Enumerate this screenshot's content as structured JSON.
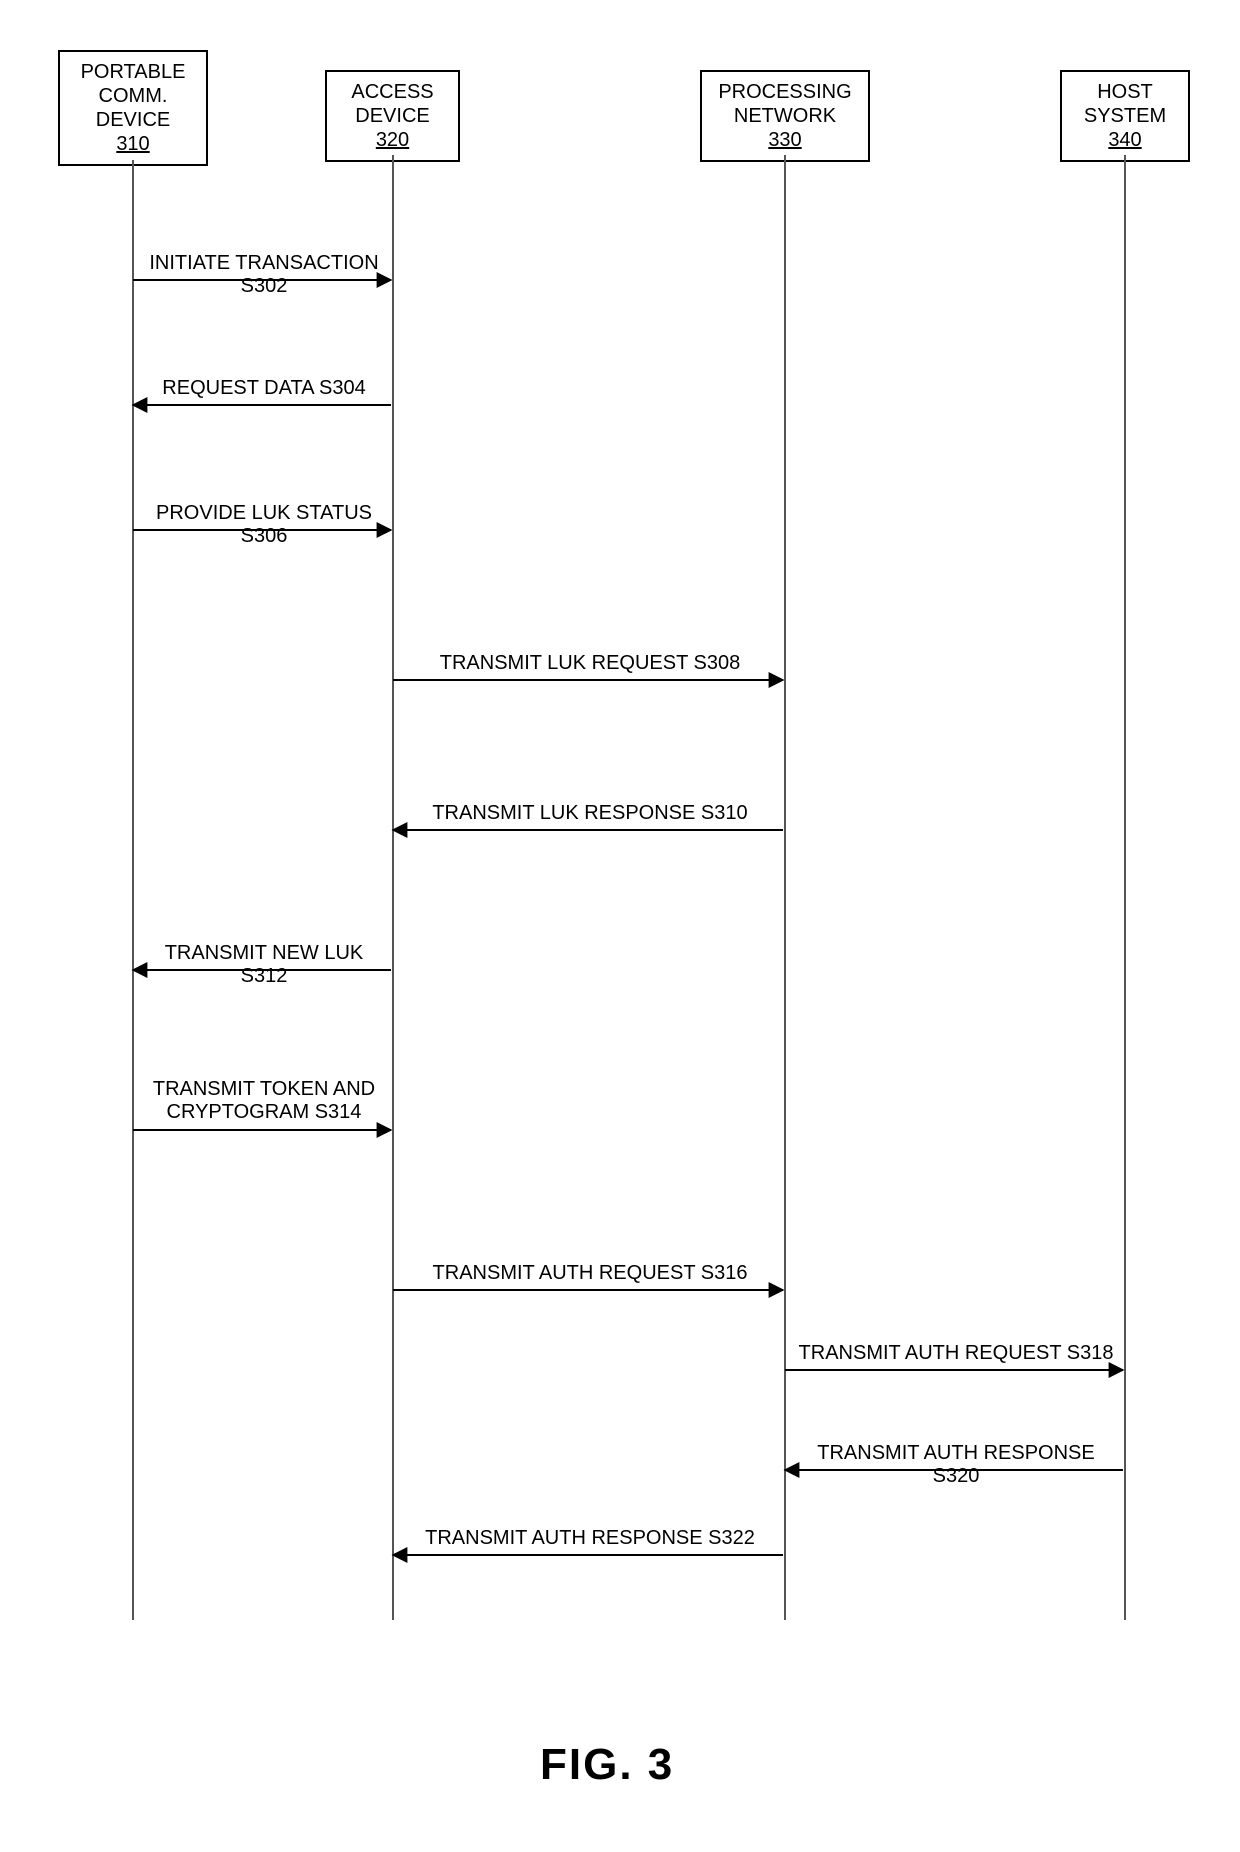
{
  "figure_label": "FIG. 3",
  "entities": {
    "portable": {
      "line1": "PORTABLE",
      "line2": "COMM.",
      "line3": "DEVICE",
      "ref": "310"
    },
    "access": {
      "line1": "ACCESS",
      "line2": "DEVICE",
      "ref": "320"
    },
    "procnet": {
      "line1": "PROCESSING",
      "line2": "NETWORK",
      "ref": "330"
    },
    "host": {
      "line1": "HOST",
      "line2": "SYSTEM",
      "ref": "340"
    }
  },
  "messages": {
    "s302": "INITIATE TRANSACTION S302",
    "s304": "REQUEST DATA S304",
    "s306": "PROVIDE LUK STATUS S306",
    "s308": "TRANSMIT LUK REQUEST S308",
    "s310": "TRANSMIT LUK RESPONSE S310",
    "s312": "TRANSMIT NEW LUK S312",
    "s314a": "TRANSMIT TOKEN AND",
    "s314b": "CRYPTOGRAM S314",
    "s316": "TRANSMIT AUTH REQUEST S316",
    "s318": "TRANSMIT AUTH REQUEST S318",
    "s320": "TRANSMIT AUTH RESPONSE S320",
    "s322": "TRANSMIT AUTH RESPONSE S322"
  }
}
